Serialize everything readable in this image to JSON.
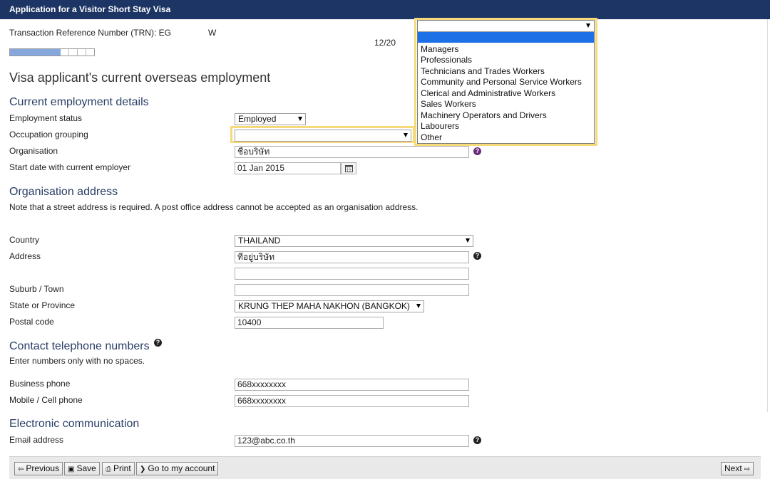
{
  "header": {
    "title": "Application for a Visitor Short Stay Visa"
  },
  "trn": {
    "label": "Transaction Reference Number (TRN): EG",
    "suffix": "W"
  },
  "progress": {
    "text": "12/20",
    "fraction": 0.6
  },
  "page_title": "Visa applicant's current overseas employment",
  "employment": {
    "heading": "Current employment details",
    "status_label": "Employment status",
    "status_value": "Employed",
    "occupation_label": "Occupation grouping",
    "occupation_value": "",
    "organisation_label": "Organisation",
    "organisation_value": "ชื่อบริษัท",
    "start_date_label": "Start date with current employer",
    "start_date_value": "01 Jan 2015"
  },
  "occupation_options": [
    "Managers",
    "Professionals",
    "Technicians and Trades Workers",
    "Community and Personal Service Workers",
    "Clerical and Administrative Workers",
    "Sales Workers",
    "Machinery Operators and Drivers",
    "Labourers",
    "Other"
  ],
  "org_address": {
    "heading": "Organisation address",
    "note": "Note that a street address is required. A post office address cannot be accepted as an organisation address.",
    "country_label": "Country",
    "country_value": "THAILAND",
    "address_label": "Address",
    "address_line1": "ที่อยู่บริษัท",
    "address_line2": "",
    "suburb_label": "Suburb / Town",
    "suburb_value": "",
    "state_label": "State or Province",
    "state_value": "KRUNG THEP MAHA NAKHON (BANGKOK)",
    "postal_label": "Postal code",
    "postal_value": "10400"
  },
  "phones": {
    "heading": "Contact telephone numbers",
    "note": "Enter numbers only with no spaces.",
    "business_label": "Business phone",
    "business_value": "668xxxxxxxx",
    "mobile_label": "Mobile / Cell phone",
    "mobile_value": "668xxxxxxxx"
  },
  "electronic": {
    "heading": "Electronic communication",
    "email_label": "Email address",
    "email_value": "123@abc.co.th"
  },
  "help_glyph": "?",
  "footer": {
    "previous": "Previous",
    "save": "Save",
    "print": "Print",
    "account": "Go to my account",
    "next": "Next"
  }
}
